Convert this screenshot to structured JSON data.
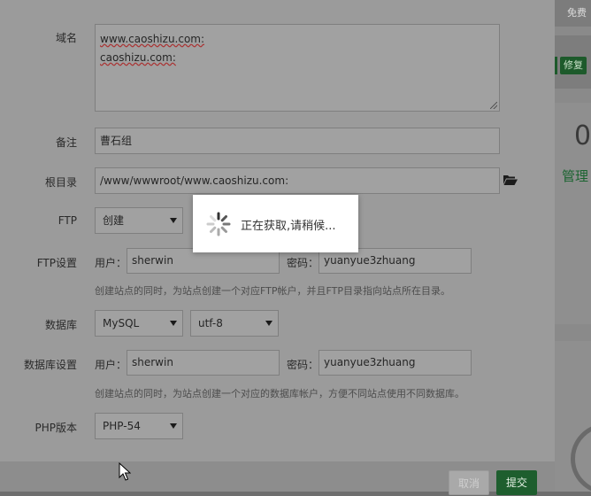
{
  "bg": {
    "free_text": "免费",
    "fix_label": "修复",
    "stat_value": "0",
    "manage_label": "管理"
  },
  "form": {
    "domain": {
      "label": "域名",
      "lines": [
        "www.caoshizu.com:",
        "caoshizu.com:"
      ]
    },
    "remark": {
      "label": "备注",
      "value": "曹石组"
    },
    "root": {
      "label": "根目录",
      "value": "/www/wwwroot/www.caoshizu.com:"
    },
    "ftp": {
      "label": "FTP",
      "selected": "创建"
    },
    "ftp_settings": {
      "label": "FTP设置",
      "user_prefix": "用户：",
      "user_value": "sherwin",
      "pass_prefix": "密码：",
      "pass_value": "yuanyue3zhuang",
      "hint": "创建站点的同时，为站点创建一个对应FTP帐户，并且FTP目录指向站点所在目录。"
    },
    "database": {
      "label": "数据库",
      "type_selected": "MySQL",
      "charset_selected": "utf-8"
    },
    "db_settings": {
      "label": "数据库设置",
      "user_prefix": "用户：",
      "user_value": "sherwin",
      "pass_prefix": "密码：",
      "pass_value": "yuanyue3zhuang",
      "hint": "创建站点的同时，为站点创建一个对应的数据库帐户，方便不同站点使用不同数据库。"
    },
    "php": {
      "label": "PHP版本",
      "selected": "PHP-54"
    }
  },
  "buttons": {
    "cancel": "取消",
    "submit": "提交"
  },
  "loading": {
    "text": "正在获取,请稍候..."
  },
  "colors": {
    "accent": "#20a53a",
    "overlay": "#9b9b9b"
  }
}
